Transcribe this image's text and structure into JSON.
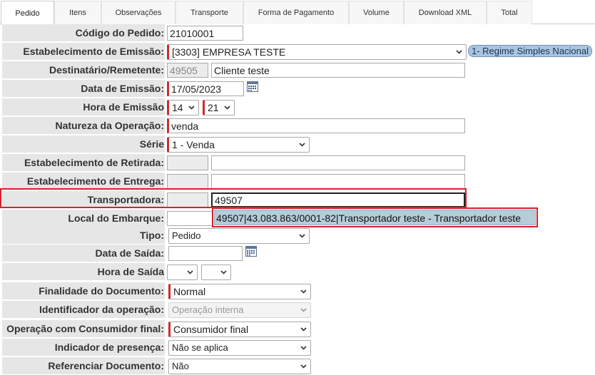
{
  "tabs": [
    {
      "label": "Pedido"
    },
    {
      "label": "Itens"
    },
    {
      "label": "Observações"
    },
    {
      "label": "Transporte"
    },
    {
      "label": "Forma de Pagamento"
    },
    {
      "label": "Volume"
    },
    {
      "label": "Download XML"
    },
    {
      "label": "Total"
    }
  ],
  "form": {
    "codigo": {
      "label": "Código do Pedido:",
      "value": "21010001"
    },
    "estab_emissao": {
      "label": "Estabelecimento de Emissão:",
      "value": "[3303] EMPRESA TESTE",
      "badge": "1- Regime Simples Nacional"
    },
    "destinatario": {
      "label": "Destinatário/Remetente:",
      "code": "49505",
      "name": "Cliente teste"
    },
    "data_emissao": {
      "label": "Data de Emissão:",
      "value": "17/05/2023"
    },
    "hora_emissao": {
      "label": "Hora de Emissão",
      "hour": "14",
      "minute": "21"
    },
    "natureza": {
      "label": "Natureza da Operação:",
      "value": "venda"
    },
    "serie": {
      "label": "Série",
      "value": "1 - Venda"
    },
    "estab_retirada": {
      "label": "Estabelecimento de Retirada:",
      "code": "",
      "name": ""
    },
    "estab_entrega": {
      "label": "Estabelecimento de Entrega:",
      "code": "",
      "name": ""
    },
    "transportadora": {
      "label": "Transportadora:",
      "code": "",
      "search": "49507"
    },
    "local_embarque": {
      "label": "Local do Embarque:",
      "value": ""
    },
    "tipo": {
      "label": "Tipo:",
      "value": "Pedido"
    },
    "data_saida": {
      "label": "Data de Saída:",
      "value": ""
    },
    "hora_saida": {
      "label": "Hora de Saída",
      "hour": "",
      "minute": ""
    },
    "finalidade": {
      "label": "Finalidade do Documento:",
      "value": "Normal"
    },
    "identificador": {
      "label": "Identificador da operação:",
      "value": "Operação interna"
    },
    "consumidor_final": {
      "label": "Operação com Consumidor final:",
      "value": "Consumidor final"
    },
    "presenca": {
      "label": "Indicador de presença:",
      "value": "Não se aplica"
    },
    "referenciar": {
      "label": "Referenciar Documento:",
      "value": "Não"
    }
  },
  "autocomplete": {
    "suggestion": "49507|43.083.863/0001-82|Transportador teste - Transportador teste"
  },
  "colors": {
    "highlight": "#d6222c",
    "required": "#d12a2a",
    "label_bg": "#e6e6e6",
    "badge_bg": "#a9c5e0",
    "suggest_bg": "#b7ccd9"
  },
  "icons": {
    "calendar": "calendar-icon",
    "dropdown": "chevron-down-icon"
  }
}
